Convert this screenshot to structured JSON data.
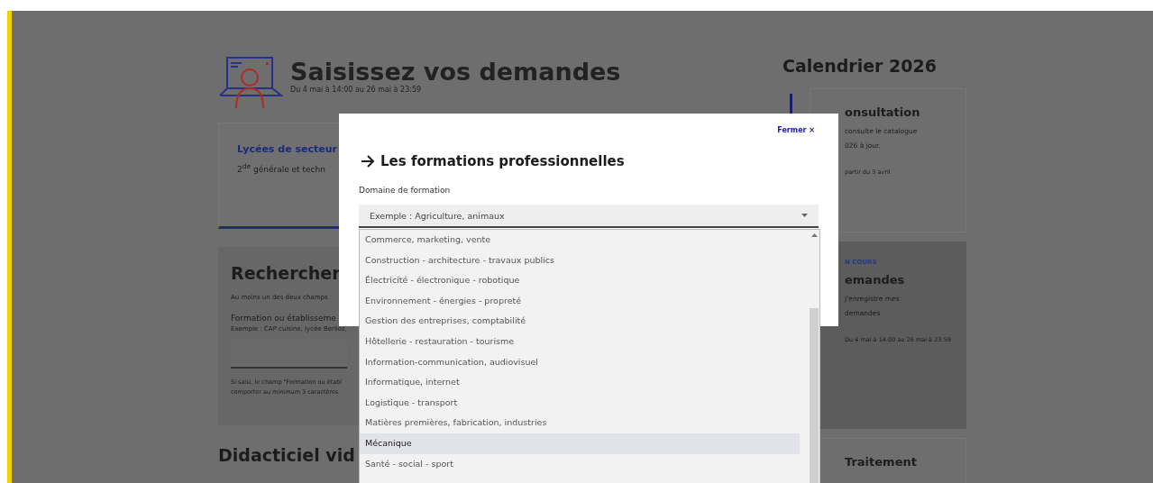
{
  "header": {
    "title": "Saisissez vos demandes",
    "dates": "Du 4 mai à 14:00 au 26 mai à 23:59"
  },
  "sector_card": {
    "title": "Lycées de secteur",
    "text": "2$^{de}$ générale et techn"
  },
  "search": {
    "title": "Rechercher",
    "hint": "Au moins un des deux champs",
    "field_label": "Formation ou établisseme",
    "field_example": "Exemple : CAP cuisine, lycée Berlioz,",
    "note_lines": [
      "Si saisi, le champ \"Formation ou établ",
      "comporter au minimum 3 caractères"
    ]
  },
  "tutorial": {
    "title": "Didacticiel vid"
  },
  "calendar": {
    "title": "Calendrier 2026",
    "steps": [
      {
        "title": "onsultation",
        "lines": [
          "consulte le catalogue",
          "026 à jour."
        ],
        "dates": "partir du 3 avril",
        "current": false
      },
      {
        "badge": "N COURS",
        "title": "emandes",
        "lines": [
          "J'enregistre mes",
          "demandes"
        ],
        "dates": "Du 4 mai à 14:00 au 26 mai à 23:59",
        "current": true
      },
      {
        "title": "Traitement",
        "current": false
      }
    ]
  },
  "modal": {
    "close": "Fermer",
    "close_icon": "×",
    "title": "Les formations professionnelles",
    "field_label": "Domaine de formation",
    "placeholder": "Exemple : Agriculture, animaux",
    "options": [
      {
        "label": "Commerce, marketing, vente",
        "selected": false
      },
      {
        "label": "Construction - architecture - travaux publics",
        "selected": false
      },
      {
        "label": "Électricité - électronique - robotique",
        "selected": false
      },
      {
        "label": "Environnement - énergies - propreté",
        "selected": false
      },
      {
        "label": "Gestion des entreprises, comptabilité",
        "selected": false
      },
      {
        "label": "Hôtellerie - restauration - tourisme",
        "selected": false
      },
      {
        "label": "Information-communication, audiovisuel",
        "selected": false
      },
      {
        "label": "Informatique, internet",
        "selected": false
      },
      {
        "label": "Logistique - transport",
        "selected": false
      },
      {
        "label": "Matières premières, fabrication, industries",
        "selected": false
      },
      {
        "label": "Mécanique",
        "selected": true
      },
      {
        "label": "Santé - social - sport",
        "selected": false
      }
    ]
  }
}
